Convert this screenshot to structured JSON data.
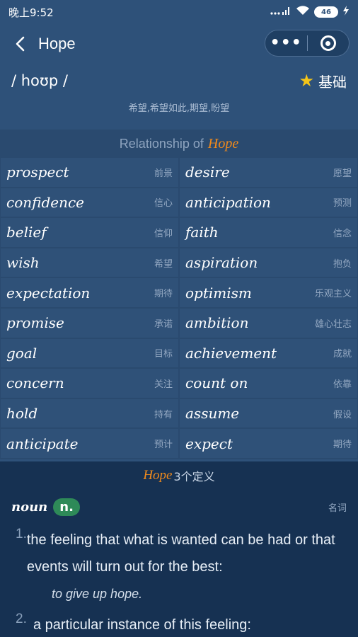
{
  "status_bar": {
    "time": "晚上9:52",
    "signal": "...",
    "wifi": "wifi",
    "battery": "46"
  },
  "header": {
    "title": "Hope",
    "back_icon": "chevron-left-icon",
    "menu_icon": "more-dots-icon",
    "close_icon": "target-icon"
  },
  "word": {
    "phonetic": "/ hoʊp /",
    "level": "基础",
    "translation": "希望,希望如此,期望,盼望"
  },
  "relationship": {
    "title_prefix": "Relationship of",
    "word": "Hope",
    "items": [
      {
        "en": "prospect",
        "cn": "前景"
      },
      {
        "en": "desire",
        "cn": "愿望"
      },
      {
        "en": "confidence",
        "cn": "信心"
      },
      {
        "en": "anticipation",
        "cn": "预测"
      },
      {
        "en": "belief",
        "cn": "信仰"
      },
      {
        "en": "faith",
        "cn": "信念"
      },
      {
        "en": "wish",
        "cn": "希望"
      },
      {
        "en": "aspiration",
        "cn": "抱负"
      },
      {
        "en": "expectation",
        "cn": "期待"
      },
      {
        "en": "optimism",
        "cn": "乐观主义"
      },
      {
        "en": "promise",
        "cn": "承诺"
      },
      {
        "en": "ambition",
        "cn": "雄心壮志"
      },
      {
        "en": "goal",
        "cn": "目标"
      },
      {
        "en": "achievement",
        "cn": "成就"
      },
      {
        "en": "concern",
        "cn": "关注"
      },
      {
        "en": "count on",
        "cn": "依靠"
      },
      {
        "en": "hold",
        "cn": "持有"
      },
      {
        "en": "assume",
        "cn": "假设"
      },
      {
        "en": "anticipate",
        "cn": "预计"
      },
      {
        "en": "expect",
        "cn": "期待"
      }
    ]
  },
  "definitions": {
    "word": "Hope",
    "count_label": "3个定义",
    "pos": "noun",
    "pos_badge": "n.",
    "pos_cn": "名词",
    "senses": [
      {
        "num": "1.",
        "text": "the feeling that what is wanted can be had or that events will turn out for the best:",
        "example": "to give up hope."
      },
      {
        "num": "2.",
        "text": "a particular instance of this feeling:"
      }
    ]
  },
  "colors": {
    "accent": "#f08a1c",
    "badge": "#2e8a58",
    "background": "#2e5179"
  }
}
